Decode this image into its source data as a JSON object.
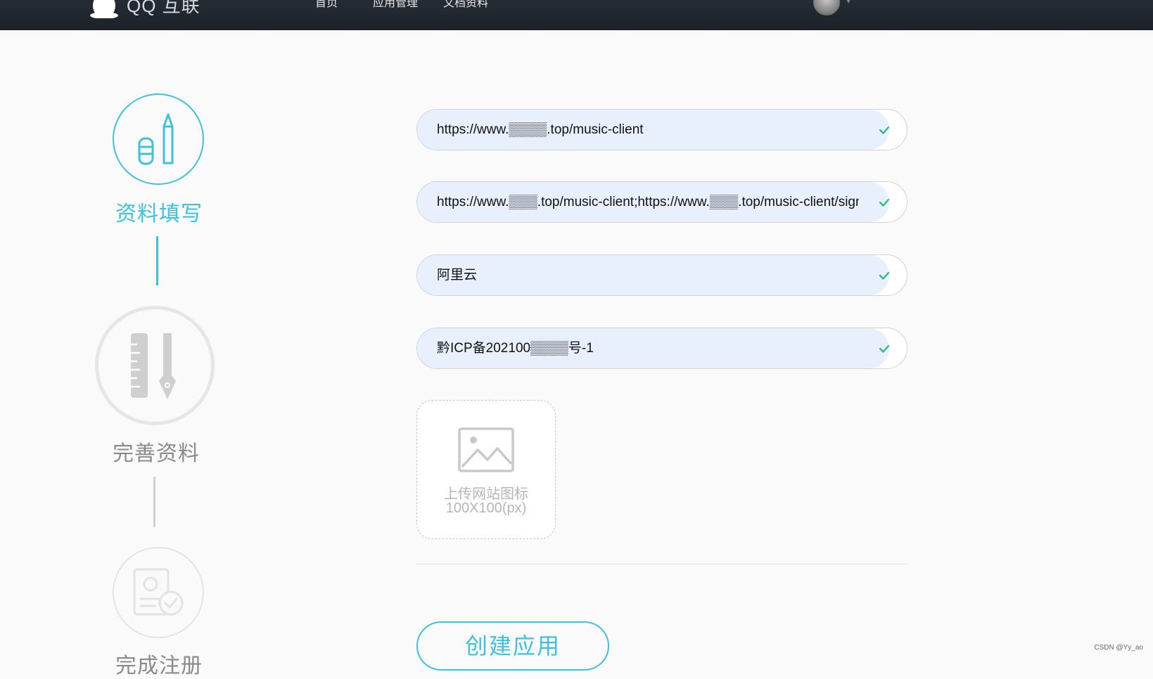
{
  "header": {
    "logo_text": "QQ 互联",
    "nav": [
      "首页",
      "应用管理",
      "文档资料"
    ],
    "caret": "▾"
  },
  "steps": [
    {
      "label": "资料填写",
      "state": "active"
    },
    {
      "label": "完善资料",
      "state": "pending"
    },
    {
      "label": "完成注册",
      "state": "pending"
    }
  ],
  "form": {
    "fields": [
      {
        "value": "https://www.▒▒▒▒.top/music-client"
      },
      {
        "value": "https://www.▒▒▒.top/music-client;https://www.▒▒▒.top/music-client/sign-"
      },
      {
        "value": "阿里云"
      },
      {
        "value": "黔ICP备202100▒▒▒▒号-1"
      }
    ],
    "upload": {
      "line1": "上传网站图标",
      "line2": "100X100(px)"
    },
    "submit_label": "创建应用"
  },
  "colors": {
    "accent": "#3fc1de",
    "check": "#2dbd7e",
    "field_fill": "#e8f0fe",
    "header_bg": "#1f252b"
  },
  "watermark": "CSDN @Yy_ao"
}
